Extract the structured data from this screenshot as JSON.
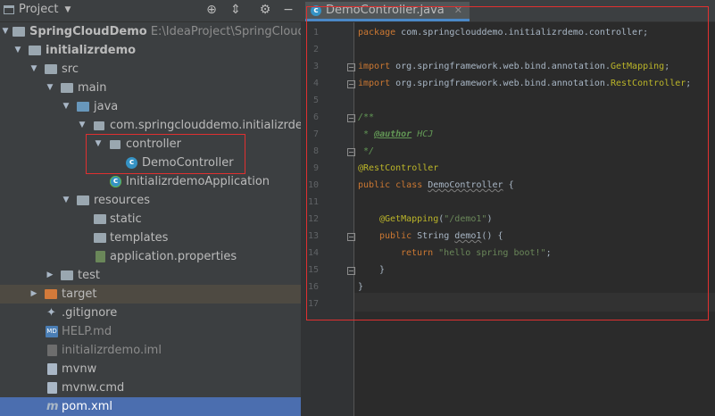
{
  "project_panel": {
    "title": "Project",
    "tree": [
      {
        "label": "SpringCloudDemo",
        "suffix": "E:\\IdeaProject\\SpringCloudDemo"
      },
      {
        "label": "initializrdemo"
      },
      {
        "label": "src"
      },
      {
        "label": "main"
      },
      {
        "label": "java"
      },
      {
        "label": "com.springclouddemo.initializrdemo"
      },
      {
        "label": "controller"
      },
      {
        "label": "DemoController"
      },
      {
        "label": "InitializrdemoApplication"
      },
      {
        "label": "resources"
      },
      {
        "label": "static"
      },
      {
        "label": "templates"
      },
      {
        "label": "application.properties"
      },
      {
        "label": "test"
      },
      {
        "label": "target"
      },
      {
        "label": ".gitignore"
      },
      {
        "label": "HELP.md"
      },
      {
        "label": "initializrdemo.iml"
      },
      {
        "label": "mvnw"
      },
      {
        "label": "mvnw.cmd"
      },
      {
        "label": "pom.xml"
      }
    ]
  },
  "editor": {
    "tab_label": "DemoController.java",
    "line_numbers": [
      "1",
      "2",
      "3",
      "4",
      "5",
      "6",
      "7",
      "8",
      "9",
      "10",
      "11",
      "12",
      "13",
      "14",
      "15",
      "16",
      "17"
    ],
    "code": {
      "l1_kw": "package",
      "l1_rest": " com.springclouddemo.initializrdemo.controller;",
      "l3_kw": "import",
      "l3_pkg": " org.springframework.web.bind.annotation.",
      "l3_cls": "GetMapping",
      "l4_kw": "import",
      "l4_pkg": " org.springframework.web.bind.annotation.",
      "l4_cls": "RestController",
      "l6": "/**",
      "l7_star": " * ",
      "l7_tag": "@author",
      "l7_val": " HCJ",
      "l8": " */",
      "l9": "@RestController",
      "l10_kw": "public class",
      "l10_name": "DemoController",
      "l10_brace": " {",
      "l12_ann": "@GetMapping",
      "l12_open": "(",
      "l12_str": "\"/demo1\"",
      "l12_close": ")",
      "l13_kw": "public",
      "l13_type": " String ",
      "l13_name": "demo1",
      "l13_rest": "() {",
      "l14_kw": "return",
      "l14_str": "\"hello spring boot!\"",
      "l14_end": ";",
      "l15": "}",
      "l16": "}"
    }
  },
  "colors": {
    "highlight_box": "#e03030",
    "selection": "#4b6eaf"
  }
}
